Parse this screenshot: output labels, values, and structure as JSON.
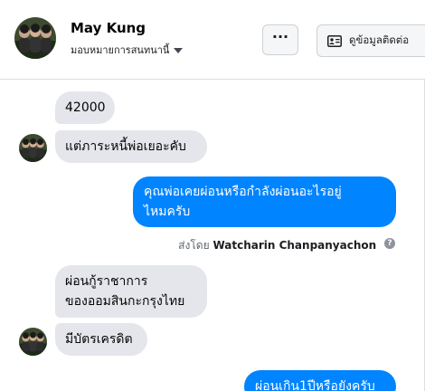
{
  "header": {
    "contact_name": "May Kung",
    "assign_label": "มอบหมายการสนทนานี้",
    "more_label": "···",
    "view_info_label": "ดูข้อมูลติดต่อ"
  },
  "messages": [
    {
      "direction": "incoming",
      "lines": [
        "42000"
      ]
    },
    {
      "direction": "incoming",
      "lines": [
        "แต่ภาระหนี้พ่อเยอะคับ"
      ]
    },
    {
      "direction": "outgoing",
      "lines": [
        "คุณพ่อเคยผ่อนหรือกำลังผ่อนอะไรอยู่",
        "ไหมครับ"
      ]
    },
    {
      "direction": "incoming",
      "lines": [
        "ผ่อนกู้ราชาการ",
        "ของออมสินกะกรุงไทย"
      ]
    },
    {
      "direction": "incoming",
      "lines": [
        "มีบัตรเครดิต"
      ]
    },
    {
      "direction": "outgoing",
      "lines": [
        "ผ่อนเกิน1ปีหรือยังครับ"
      ]
    }
  ],
  "sent_by": {
    "prefix": "ส่งโดย",
    "name": "Watcharin Chanpanyachon",
    "help_glyph": "?"
  },
  "colors": {
    "outgoing_bubble": "#0084ff",
    "incoming_bubble": "#e4e6eb"
  },
  "icons": [
    "avatar-photo",
    "caret-down-icon",
    "more-dots-icon",
    "contact-card-icon",
    "help-icon"
  ]
}
